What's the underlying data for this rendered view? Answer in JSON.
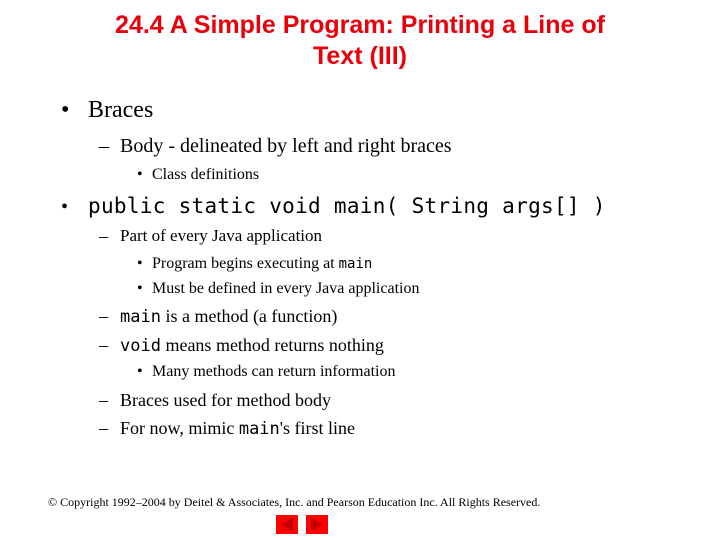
{
  "slide": {
    "title": "24.4  A Simple Program: Printing a Line of Text (III)",
    "title_line1": "24.4  A Simple Program: Printing a Line of",
    "title_line2": "Text (III)",
    "title_color": "#E8000B",
    "bullets": {
      "b1": {
        "marker": "•",
        "text": "Braces"
      },
      "b1_1": {
        "marker": "–",
        "text": "Body - delineated by left and right braces"
      },
      "b1_1_1": {
        "marker": "•",
        "text": "Class definitions"
      },
      "b2": {
        "marker": "•",
        "code": "public static void main( String args[] )"
      },
      "b2_1": {
        "marker": "–",
        "text": "Part of every Java application"
      },
      "b2_1_1": {
        "marker": "•",
        "text": "Program begins executing at ",
        "code": "main"
      },
      "b2_1_2": {
        "marker": "•",
        "text": "Must be defined in every Java application"
      },
      "b2_2": {
        "marker": "–",
        "code": "main",
        "text": " is a method (a function)"
      },
      "b2_3": {
        "marker": "–",
        "code": "void",
        "text": " means method returns nothing"
      },
      "b2_3_1": {
        "marker": "•",
        "text": "Many methods can return information"
      },
      "b2_4": {
        "marker": "–",
        "text": "Braces used for method body"
      },
      "b2_5": {
        "marker": "–",
        "text_before": "For now, mimic ",
        "code": "main",
        "text_after": "'s first line"
      }
    }
  },
  "footer": {
    "copyright": "© Copyright 1992–2004 by Deitel & Associates, Inc. and Pearson Education Inc. All Rights Reserved."
  },
  "navigation": {
    "prev_icon": "triangle-left-icon",
    "next_icon": "triangle-right-icon",
    "button_color": "#FF0000",
    "arrow_color": "#C00000"
  }
}
